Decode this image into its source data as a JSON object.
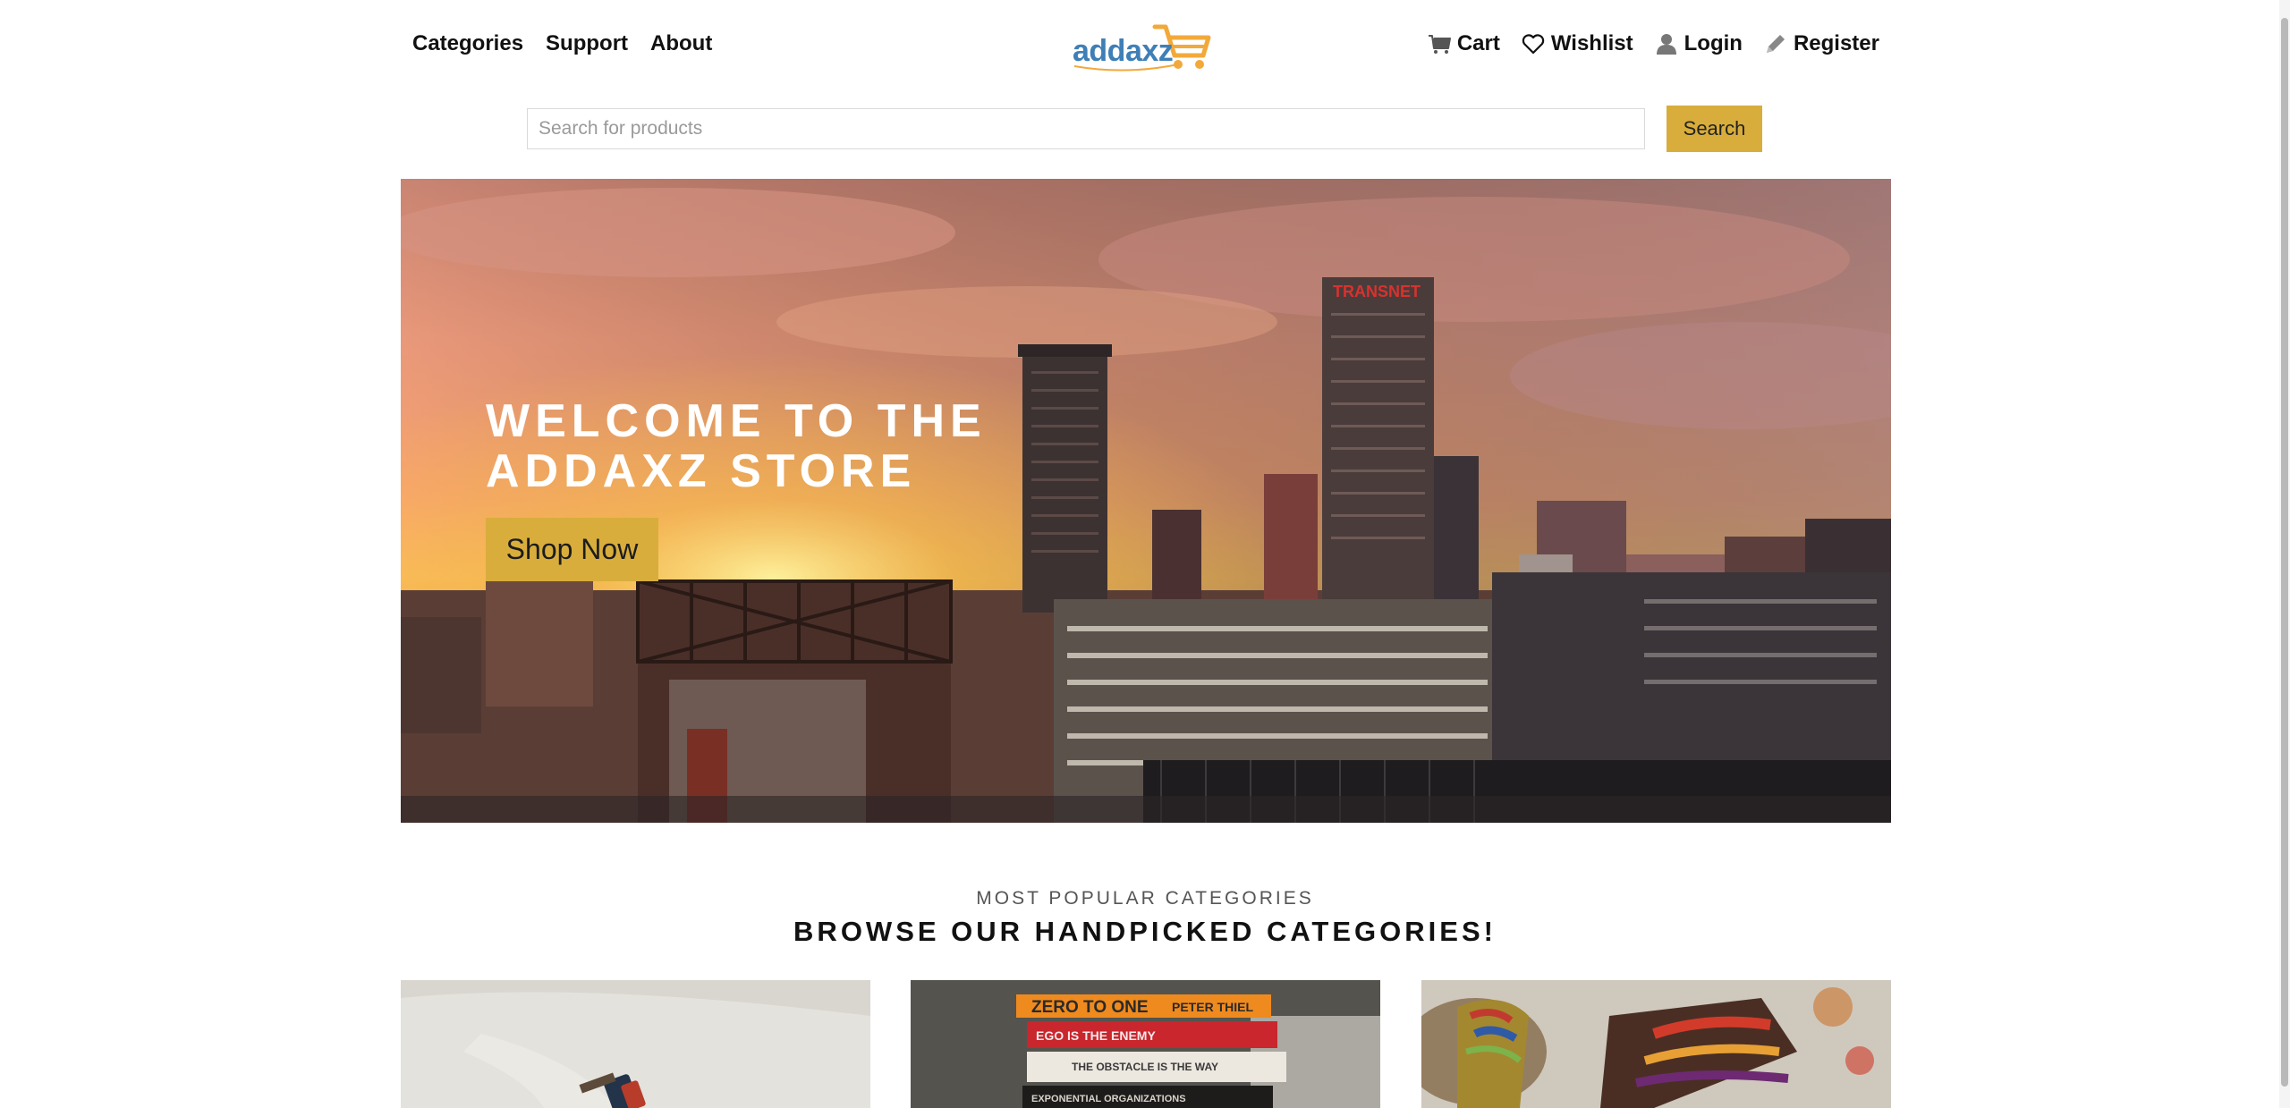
{
  "header": {
    "nav_left": [
      {
        "label": "Categories"
      },
      {
        "label": "Support"
      },
      {
        "label": "About"
      }
    ],
    "logo": {
      "text": "addaxz",
      "icon": "shopping-cart-icon"
    },
    "nav_right": [
      {
        "label": "Cart",
        "icon": "cart-icon"
      },
      {
        "label": "Wishlist",
        "icon": "heart-icon"
      },
      {
        "label": "Login",
        "icon": "user-icon"
      },
      {
        "label": "Register",
        "icon": "pencil-icon"
      }
    ]
  },
  "search": {
    "placeholder": "Search for products",
    "value": "",
    "button_label": "Search"
  },
  "hero": {
    "title": "WELCOME TO THE ADDAXZ STORE",
    "button_label": "Shop Now",
    "sign_text": "TRANSNET"
  },
  "categories": {
    "subtitle": "MOST POPULAR CATEGORIES",
    "title": "BROWSE OUR HANDPICKED CATEGORIES!",
    "book_titles": [
      "ZERO TO ONE",
      "PETER THIEL",
      "EGO IS THE ENEMY",
      "THE OBSTACLE IS THE WAY",
      "EXPONENTIAL ORGANIZATIONS"
    ]
  },
  "colors": {
    "accent": "#d8ad3c",
    "logo_blue": "#3f7fb7",
    "logo_orange": "#f2a93b",
    "text": "#111111"
  }
}
